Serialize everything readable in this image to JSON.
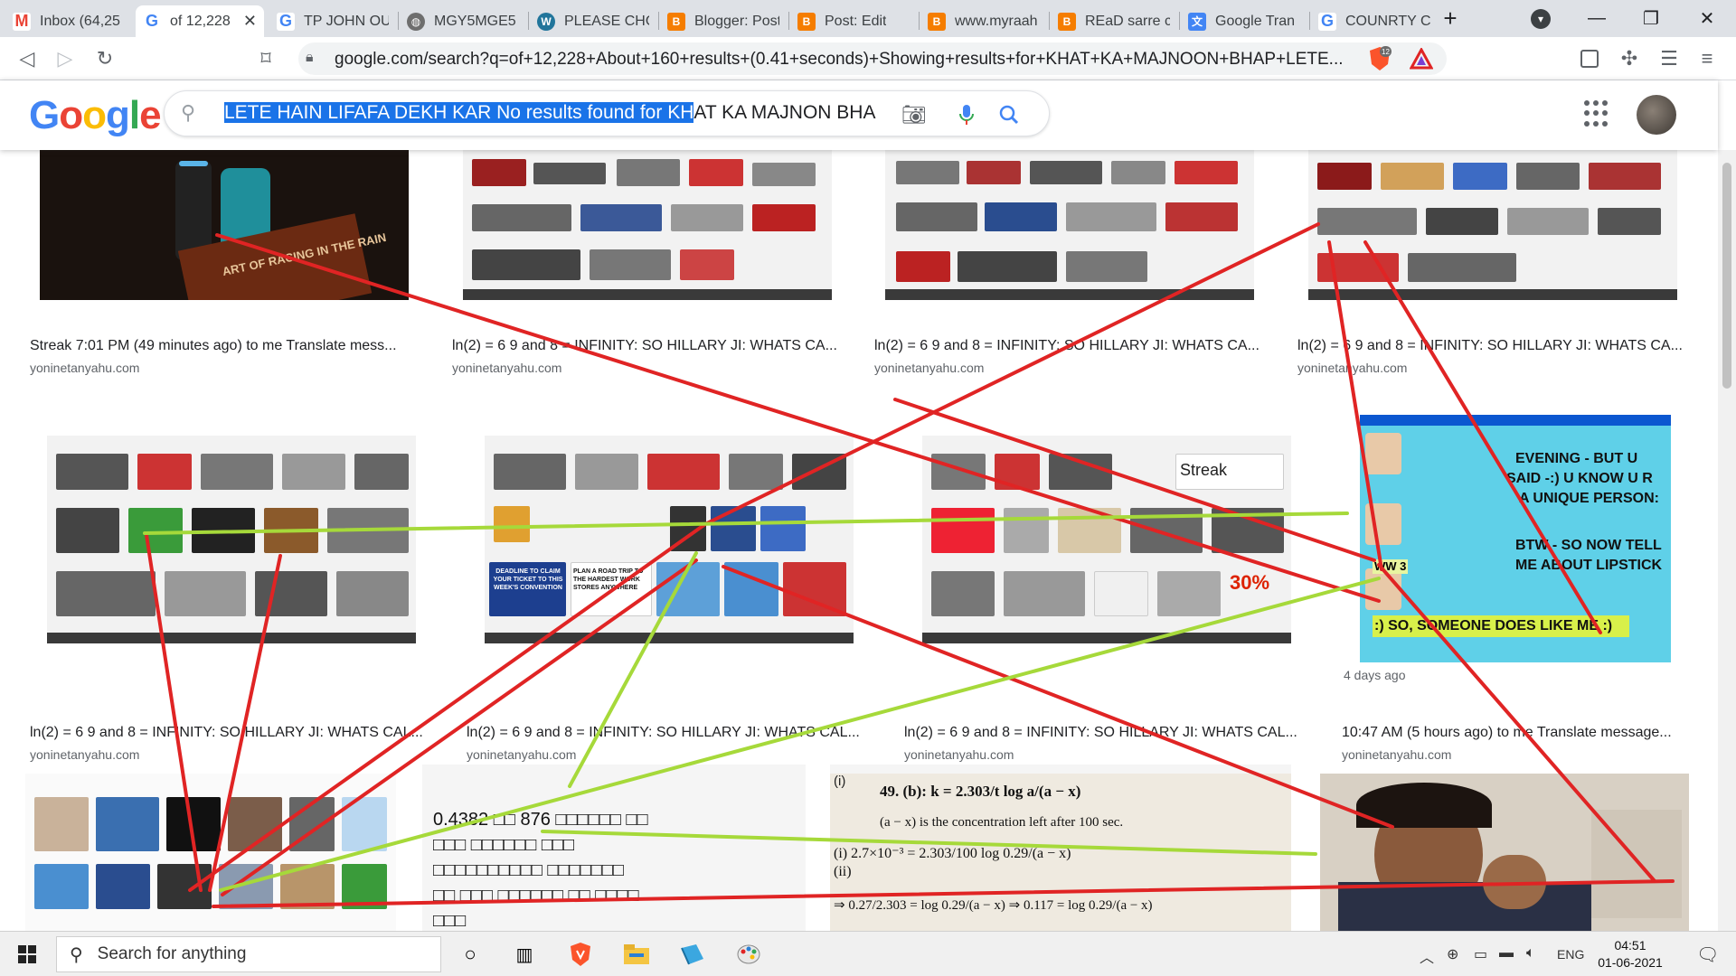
{
  "browser": {
    "tabs": [
      {
        "label": "Inbox (64,25",
        "icon": "gmail-icon",
        "active": false
      },
      {
        "label": "of 12,228",
        "icon": "google-icon",
        "active": true
      },
      {
        "label": "TP JOHN OU",
        "icon": "google-icon",
        "active": false
      },
      {
        "label": "MGY5MGE5",
        "icon": "globe-icon",
        "active": false
      },
      {
        "label": "PLEASE CHO",
        "icon": "wordpress-icon",
        "active": false
      },
      {
        "label": "Blogger: Post",
        "icon": "blogger-icon",
        "active": false
      },
      {
        "label": "Post: Edit",
        "icon": "blogger-icon",
        "active": false
      },
      {
        "label": "www.myraah",
        "icon": "blogger-icon",
        "active": false
      },
      {
        "label": "REaD sarre c",
        "icon": "blogger-icon",
        "active": false
      },
      {
        "label": "Google Tran",
        "icon": "translate-icon",
        "active": false
      },
      {
        "label": "COUNRTY C",
        "icon": "google-icon",
        "active": false
      }
    ],
    "url": "google.com/search?q=of+12,228+About+160+results+(0.41+seconds)+Showing+results+for+KHAT+KA+MAJNOON+BHAP+LETE...",
    "shield_badge": "12"
  },
  "search": {
    "logo": "Google",
    "query_selected": "LETE HAIN LIFAFA DEKH KAR No results found for KH",
    "query_rest": "AT KA MAJNON BHA"
  },
  "results": [
    {
      "caption": "Streak 7:01 PM (49 minutes ago) to me Translate mess...",
      "source": "yoninetanyahu.com",
      "book_text": "ART OF RACING IN THE RAIN"
    },
    {
      "caption": "ln(2) = 6 9 and 8 = INFINITY: SO HILLARY JI: WHATS CA...",
      "source": "yoninetanyahu.com"
    },
    {
      "caption": "ln(2) = 6 9 and 8 = INFINITY: SO HILLARY JI: WHATS CA...",
      "source": "yoninetanyahu.com"
    },
    {
      "caption": "ln(2) = 6 9 and 8 = INFINITY: SO HILLARY JI: WHATS CA...",
      "source": "yoninetanyahu.com"
    },
    {
      "caption": "ln(2) = 6 9 and 8 = INFINITY: SO HILLARY JI: WHATS CAL...",
      "source": "yoninetanyahu.com"
    },
    {
      "caption": "ln(2) = 6 9 and 8 = INFINITY: SO HILLARY JI: WHATS CAL...",
      "source": "yoninetanyahu.com",
      "inner_text": [
        "DEADLINE TO CLAIM YOUR TICKET TO THIS WEEK'S CONVENTION",
        "PLAN A ROAD TRIP TO THE HARDEST WORK STORES ANYWHERE"
      ]
    },
    {
      "caption": "ln(2) = 6 9 and 8 = INFINITY: SO HILLARY JI: WHATS CAL...",
      "source": "yoninetanyahu.com",
      "inner_text": [
        "Streak",
        "30%"
      ]
    },
    {
      "caption": "10:47 AM (5 hours ago) to me Translate message...",
      "source": "yoninetanyahu.com",
      "age": "4 days ago",
      "chat_lines": [
        "EVENING - BUT U",
        "SAID -:) U KNOW U R",
        "A UNIQUE PERSON:",
        "BTW - SO NOW TELL",
        "ME ABOUT LIPSTICK",
        ":) SO, SOMEONE DOES LIKE ME :)",
        "WW 3"
      ]
    },
    {
      "caption": "",
      "source": ""
    },
    {
      "caption": "",
      "source": "",
      "text_lines": [
        "0.4382 □□ 876 □□□□□□ □□",
        "□□□ □□□□□□ □□□",
        "□□□□□□□□□□ □□□□□□□",
        "□□ □□□ □□□□□□ □□ □□□□",
        "□□□"
      ]
    },
    {
      "caption": "",
      "source": "",
      "math_lines": [
        "49. (b): k = 2.303/t log a/(a − x)",
        "(a − x) is the concentration left after 100 sec.",
        "(i) 2.7×10⁻³ = 2.303/100 log 0.29/(a − x)",
        "(ii)",
        "⇒ 0.27/2.303 = log 0.29/(a − x) ⇒ 0.117 = log 0.29/(a − x)"
      ]
    },
    {
      "caption": "",
      "source": ""
    }
  ],
  "taskbar": {
    "search_placeholder": "Search for anything",
    "lang": "ENG",
    "time": "04:51",
    "date": "01-06-2021"
  },
  "colors": {
    "annotation_red": "#e02424",
    "annotation_green": "#a6d93a",
    "google_blue": "#4285f4",
    "google_red": "#ea4335",
    "google_yellow": "#fbbc05",
    "google_green": "#34a853"
  }
}
